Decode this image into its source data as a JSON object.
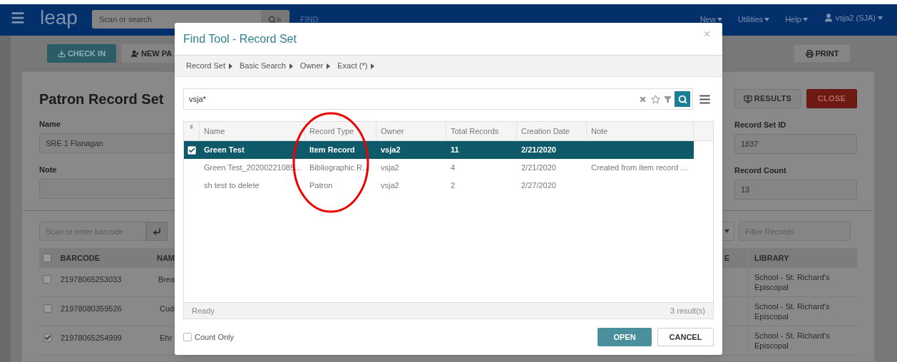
{
  "navbar": {
    "logo": "leap",
    "search": {
      "placeholder": "Scan or search"
    },
    "find_link": "FIND",
    "menus": [
      "New",
      "Utilities",
      "Help"
    ],
    "user": "vsja2 (SJA)"
  },
  "toolbar": {
    "left_buttons": [
      {
        "kind": "checkin",
        "label": "CHECK IN"
      },
      {
        "kind": "new",
        "label": "NEW PA"
      }
    ],
    "print": "PRINT"
  },
  "record_set": {
    "title": "Patron Record Set",
    "fields": [
      {
        "label": "Name",
        "value": "SRE 1 Flanagan"
      },
      {
        "label": "Note"
      }
    ],
    "buttons": [
      {
        "kind": "results",
        "label": "RESULTS"
      },
      {
        "kind": "close",
        "label": "CLOSE"
      }
    ],
    "info_fields": [
      {
        "label": "Record Set ID",
        "value": "1837"
      },
      {
        "label": "Record Count",
        "value": "13"
      }
    ]
  },
  "items": {
    "barcode_field": {
      "placeholder": "Scan or enter barcode"
    },
    "filter_field": {
      "placeholder": "Filter Records"
    },
    "all_checked": false,
    "columns": [
      "BARCODE",
      "NAM",
      "E",
      "LIBRARY"
    ],
    "rows": [
      {
        "checked": false,
        "barcode": "21978065253033",
        "name": "Brea",
        "library": "School - St. Richard's Episcopal"
      },
      {
        "checked": false,
        "barcode": "21978080359526",
        "name": "Cud",
        "library": "School - St. Richard's Episcopal"
      },
      {
        "checked": true,
        "barcode": "21978065254999",
        "name": "Ehr",
        "library": "School - St. Richard's Episcopal"
      }
    ]
  },
  "dialog": {
    "title": "Find Tool - Record Set",
    "breadcrumb": [
      "Record Set",
      "Basic Search",
      "Owner",
      "Exact (*)"
    ],
    "search": {
      "value": "vsja*"
    },
    "columns": [
      "Name",
      "Record Type",
      "Owner",
      "Total Records",
      "Creation Date",
      "Note"
    ],
    "rows": [
      {
        "selected": true,
        "cells": [
          "Green Test",
          "Item Record",
          "vsja2",
          "11",
          "2/21/2020",
          ""
        ]
      },
      {
        "selected": false,
        "cells": [
          "Green Test_20200221085…",
          "Bibliographic R…",
          "vsja2",
          "4",
          "2/21/2020",
          "Created from item record …"
        ]
      },
      {
        "selected": false,
        "cells": [
          "sh test to delete",
          "Patron",
          "vsja2",
          "2",
          "2/27/2020",
          ""
        ]
      }
    ],
    "status": "Ready",
    "result_count": "3 result(s)",
    "count_only": {
      "label": "Count Only",
      "checked": false
    },
    "buttons": [
      {
        "kind": "primary",
        "label": "OPEN"
      },
      {
        "kind": "secondary",
        "label": "CANCEL"
      }
    ]
  }
}
